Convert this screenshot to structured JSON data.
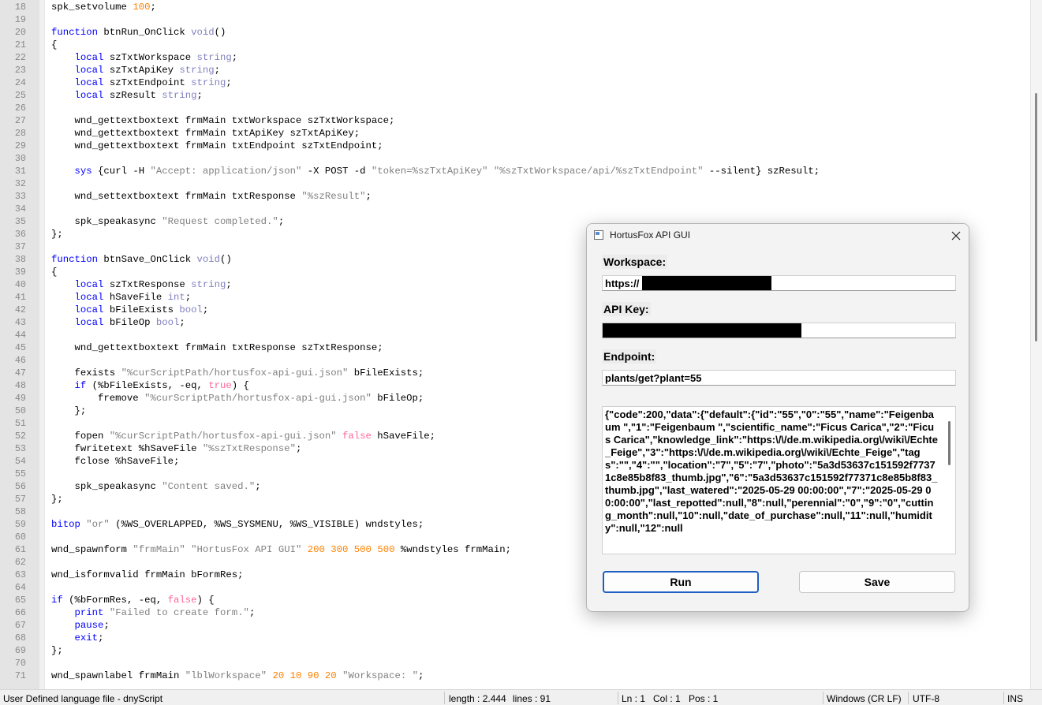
{
  "editor": {
    "lines": [
      {
        "n": "18",
        "t": [
          [
            "p",
            "spk_setvolume "
          ],
          [
            "num",
            "100"
          ],
          [
            "p",
            ";"
          ]
        ]
      },
      {
        "n": "19",
        "t": []
      },
      {
        "n": "20",
        "t": [
          [
            "kw",
            "function"
          ],
          [
            "p",
            " btnRun_OnClick "
          ],
          [
            "ty",
            "void"
          ],
          [
            "p",
            "()"
          ]
        ]
      },
      {
        "n": "21",
        "t": [
          [
            "p",
            "{"
          ]
        ]
      },
      {
        "n": "22",
        "t": [
          [
            "p",
            "    "
          ],
          [
            "kw",
            "local"
          ],
          [
            "p",
            " szTxtWorkspace "
          ],
          [
            "ty",
            "string"
          ],
          [
            "p",
            ";"
          ]
        ]
      },
      {
        "n": "23",
        "t": [
          [
            "p",
            "    "
          ],
          [
            "kw",
            "local"
          ],
          [
            "p",
            " szTxtApiKey "
          ],
          [
            "ty",
            "string"
          ],
          [
            "p",
            ";"
          ]
        ]
      },
      {
        "n": "24",
        "t": [
          [
            "p",
            "    "
          ],
          [
            "kw",
            "local"
          ],
          [
            "p",
            " szTxtEndpoint "
          ],
          [
            "ty",
            "string"
          ],
          [
            "p",
            ";"
          ]
        ]
      },
      {
        "n": "25",
        "t": [
          [
            "p",
            "    "
          ],
          [
            "kw",
            "local"
          ],
          [
            "p",
            " szResult "
          ],
          [
            "ty",
            "string"
          ],
          [
            "p",
            ";"
          ]
        ]
      },
      {
        "n": "26",
        "t": []
      },
      {
        "n": "27",
        "t": [
          [
            "p",
            "    wnd_gettextboxtext frmMain txtWorkspace szTxtWorkspace;"
          ]
        ]
      },
      {
        "n": "28",
        "t": [
          [
            "p",
            "    wnd_gettextboxtext frmMain txtApiKey szTxtApiKey;"
          ]
        ]
      },
      {
        "n": "29",
        "t": [
          [
            "p",
            "    wnd_gettextboxtext frmMain txtEndpoint szTxtEndpoint;"
          ]
        ]
      },
      {
        "n": "30",
        "t": []
      },
      {
        "n": "31",
        "t": [
          [
            "p",
            "    "
          ],
          [
            "kw",
            "sys"
          ],
          [
            "p",
            " {curl -H "
          ],
          [
            "str",
            "\"Accept: application/json\""
          ],
          [
            "p",
            " -X POST -d "
          ],
          [
            "str",
            "\"token=%szTxtApiKey\""
          ],
          [
            "p",
            " "
          ],
          [
            "str",
            "\"%szTxtWorkspace/api/%szTxtEndpoint\""
          ],
          [
            "p",
            " --silent} szResult;"
          ]
        ]
      },
      {
        "n": "32",
        "t": []
      },
      {
        "n": "33",
        "t": [
          [
            "p",
            "    wnd_settextboxtext frmMain txtResponse "
          ],
          [
            "str",
            "\"%szResult\""
          ],
          [
            "p",
            ";"
          ]
        ]
      },
      {
        "n": "34",
        "t": []
      },
      {
        "n": "35",
        "t": [
          [
            "p",
            "    spk_speakasync "
          ],
          [
            "str",
            "\"Request completed.\""
          ],
          [
            "p",
            ";"
          ]
        ]
      },
      {
        "n": "36",
        "t": [
          [
            "p",
            "};"
          ]
        ]
      },
      {
        "n": "37",
        "t": []
      },
      {
        "n": "38",
        "t": [
          [
            "kw",
            "function"
          ],
          [
            "p",
            " btnSave_OnClick "
          ],
          [
            "ty",
            "void"
          ],
          [
            "p",
            "()"
          ]
        ]
      },
      {
        "n": "39",
        "t": [
          [
            "p",
            "{"
          ]
        ]
      },
      {
        "n": "40",
        "t": [
          [
            "p",
            "    "
          ],
          [
            "kw",
            "local"
          ],
          [
            "p",
            " szTxtResponse "
          ],
          [
            "ty",
            "string"
          ],
          [
            "p",
            ";"
          ]
        ]
      },
      {
        "n": "41",
        "t": [
          [
            "p",
            "    "
          ],
          [
            "kw",
            "local"
          ],
          [
            "p",
            " hSaveFile "
          ],
          [
            "ty",
            "int"
          ],
          [
            "p",
            ";"
          ]
        ]
      },
      {
        "n": "42",
        "t": [
          [
            "p",
            "    "
          ],
          [
            "kw",
            "local"
          ],
          [
            "p",
            " bFileExists "
          ],
          [
            "ty",
            "bool"
          ],
          [
            "p",
            ";"
          ]
        ]
      },
      {
        "n": "43",
        "t": [
          [
            "p",
            "    "
          ],
          [
            "kw",
            "local"
          ],
          [
            "p",
            " bFileOp "
          ],
          [
            "ty",
            "bool"
          ],
          [
            "p",
            ";"
          ]
        ]
      },
      {
        "n": "44",
        "t": []
      },
      {
        "n": "45",
        "t": [
          [
            "p",
            "    wnd_gettextboxtext frmMain txtResponse szTxtResponse;"
          ]
        ]
      },
      {
        "n": "46",
        "t": []
      },
      {
        "n": "47",
        "t": [
          [
            "p",
            "    fexists "
          ],
          [
            "str",
            "\"%curScriptPath/hortusfox-api-gui.json\""
          ],
          [
            "p",
            " bFileExists;"
          ]
        ]
      },
      {
        "n": "48",
        "t": [
          [
            "p",
            "    "
          ],
          [
            "kw",
            "if"
          ],
          [
            "p",
            " (%bFileExists, -eq, "
          ],
          [
            "bool",
            "true"
          ],
          [
            "p",
            ") {"
          ]
        ]
      },
      {
        "n": "49",
        "t": [
          [
            "p",
            "        fremove "
          ],
          [
            "str",
            "\"%curScriptPath/hortusfox-api-gui.json\""
          ],
          [
            "p",
            " bFileOp;"
          ]
        ]
      },
      {
        "n": "50",
        "t": [
          [
            "p",
            "    };"
          ]
        ]
      },
      {
        "n": "51",
        "t": []
      },
      {
        "n": "52",
        "t": [
          [
            "p",
            "    fopen "
          ],
          [
            "str",
            "\"%curScriptPath/hortusfox-api-gui.json\""
          ],
          [
            "p",
            " "
          ],
          [
            "bool",
            "false"
          ],
          [
            "p",
            " hSaveFile;"
          ]
        ]
      },
      {
        "n": "53",
        "t": [
          [
            "p",
            "    fwritetext %hSaveFile "
          ],
          [
            "str",
            "\"%szTxtResponse\""
          ],
          [
            "p",
            ";"
          ]
        ]
      },
      {
        "n": "54",
        "t": [
          [
            "p",
            "    fclose %hSaveFile;"
          ]
        ]
      },
      {
        "n": "55",
        "t": []
      },
      {
        "n": "56",
        "t": [
          [
            "p",
            "    spk_speakasync "
          ],
          [
            "str",
            "\"Content saved.\""
          ],
          [
            "p",
            ";"
          ]
        ]
      },
      {
        "n": "57",
        "t": [
          [
            "p",
            "};"
          ]
        ]
      },
      {
        "n": "58",
        "t": []
      },
      {
        "n": "59",
        "t": [
          [
            "kw",
            "bitop"
          ],
          [
            "p",
            " "
          ],
          [
            "str",
            "\"or\""
          ],
          [
            "p",
            " (%WS_OVERLAPPED, %WS_SYSMENU, %WS_VISIBLE) wndstyles;"
          ]
        ]
      },
      {
        "n": "60",
        "t": []
      },
      {
        "n": "61",
        "t": [
          [
            "p",
            "wnd_spawnform "
          ],
          [
            "str",
            "\"frmMain\""
          ],
          [
            "p",
            " "
          ],
          [
            "str",
            "\"HortusFox API GUI\""
          ],
          [
            "p",
            " "
          ],
          [
            "num",
            "200"
          ],
          [
            "p",
            " "
          ],
          [
            "num",
            "300"
          ],
          [
            "p",
            " "
          ],
          [
            "num",
            "500"
          ],
          [
            "p",
            " "
          ],
          [
            "num",
            "500"
          ],
          [
            "p",
            " %wndstyles frmMain;"
          ]
        ]
      },
      {
        "n": "62",
        "t": []
      },
      {
        "n": "63",
        "t": [
          [
            "p",
            "wnd_isformvalid frmMain bFormRes;"
          ]
        ]
      },
      {
        "n": "64",
        "t": []
      },
      {
        "n": "65",
        "t": [
          [
            "kw",
            "if"
          ],
          [
            "p",
            " (%bFormRes, -eq, "
          ],
          [
            "bool",
            "false"
          ],
          [
            "p",
            ") {"
          ]
        ]
      },
      {
        "n": "66",
        "t": [
          [
            "p",
            "    "
          ],
          [
            "kw",
            "print"
          ],
          [
            "p",
            " "
          ],
          [
            "str",
            "\"Failed to create form.\""
          ],
          [
            "p",
            ";"
          ]
        ]
      },
      {
        "n": "67",
        "t": [
          [
            "p",
            "    "
          ],
          [
            "kw",
            "pause"
          ],
          [
            "p",
            ";"
          ]
        ]
      },
      {
        "n": "68",
        "t": [
          [
            "p",
            "    "
          ],
          [
            "kw",
            "exit"
          ],
          [
            "p",
            ";"
          ]
        ]
      },
      {
        "n": "69",
        "t": [
          [
            "p",
            "};"
          ]
        ]
      },
      {
        "n": "70",
        "t": []
      },
      {
        "n": "71",
        "t": [
          [
            "p",
            "wnd_spawnlabel frmMain "
          ],
          [
            "str",
            "\"lblWorkspace\""
          ],
          [
            "p",
            " "
          ],
          [
            "num",
            "20"
          ],
          [
            "p",
            " "
          ],
          [
            "num",
            "10"
          ],
          [
            "p",
            " "
          ],
          [
            "num",
            "90"
          ],
          [
            "p",
            " "
          ],
          [
            "num",
            "20"
          ],
          [
            "p",
            " "
          ],
          [
            "str",
            "\"Workspace: \""
          ],
          [
            "p",
            ";"
          ]
        ]
      }
    ]
  },
  "statusbar": {
    "language": "User Defined language file - dnyScript",
    "length": "length : 2.444",
    "lines": "lines : 91",
    "ln": "Ln : 1",
    "col": "Col : 1",
    "pos": "Pos : 1",
    "eol": "Windows (CR LF)",
    "encoding": "UTF-8",
    "mode": "INS"
  },
  "dialog": {
    "title": "HortusFox API GUI",
    "workspace_label": "Workspace:",
    "workspace_value": "https://",
    "apikey_label": "API Key:",
    "apikey_value": "",
    "endpoint_label": "Endpoint:",
    "endpoint_value": "plants/get?plant=55",
    "response_text": "{\"code\":200,\"data\":{\"default\":{\"id\":\"55\",\"0\":\"55\",\"name\":\"Feigenbaum \",\"1\":\"Feigenbaum \",\"scientific_name\":\"Ficus Carica\",\"2\":\"Ficus Carica\",\"knowledge_link\":\"https:\\/\\/de.m.wikipedia.org\\/wiki\\/Echte_Feige\",\"3\":\"https:\\/\\/de.m.wikipedia.org\\/wiki\\/Echte_Feige\",\"tags\":\"\",\"4\":\"\",\"location\":\"7\",\"5\":\"7\",\"photo\":\"5a3d53637c151592f77371c8e85b8f83_thumb.jpg\",\"6\":\"5a3d53637c151592f77371c8e85b8f83_thumb.jpg\",\"last_watered\":\"2025-05-29 00:00:00\",\"7\":\"2025-05-29 00:00:00\",\"last_repotted\":null,\"8\":null,\"perennial\":\"0\",\"9\":\"0\",\"cutting_month\":null,\"10\":null,\"date_of_purchase\":null,\"11\":null,\"humidity\":null,\"12\":null",
    "run_label": "Run",
    "save_label": "Save"
  },
  "colors": {
    "keyword": "#0000ff",
    "type": "#8080c0",
    "string": "#808080",
    "number": "#ff8000",
    "boolean": "#ff6699",
    "focus_border": "#1f5fbf"
  }
}
